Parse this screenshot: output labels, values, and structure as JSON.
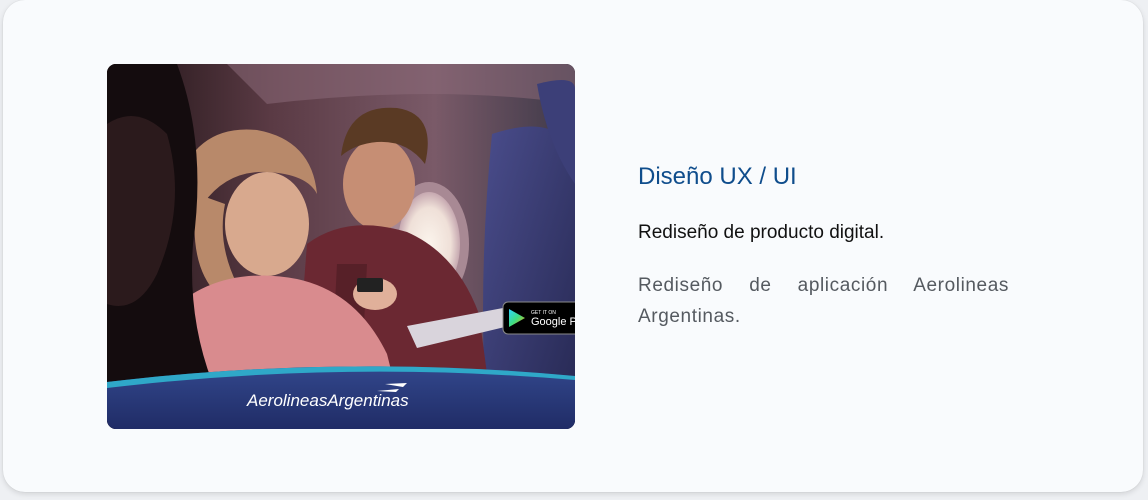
{
  "project": {
    "category": "Diseño UX / UI",
    "subtitle": "Rediseño de producto digital.",
    "description": "Rediseño de aplicación Aerolineas Argentinas."
  },
  "image": {
    "brand_name": "AerolineasArgentinas",
    "store_badge_small": "GET IT ON",
    "store_badge_large": "Google P",
    "icons": [
      "google-play-icon",
      "airline-logo-icon"
    ]
  },
  "colors": {
    "accent": "#0f4d8c",
    "card_bg": "#f9fbfd",
    "banner": "#2b3d7f",
    "banner_stripe": "#2fa8c8"
  }
}
